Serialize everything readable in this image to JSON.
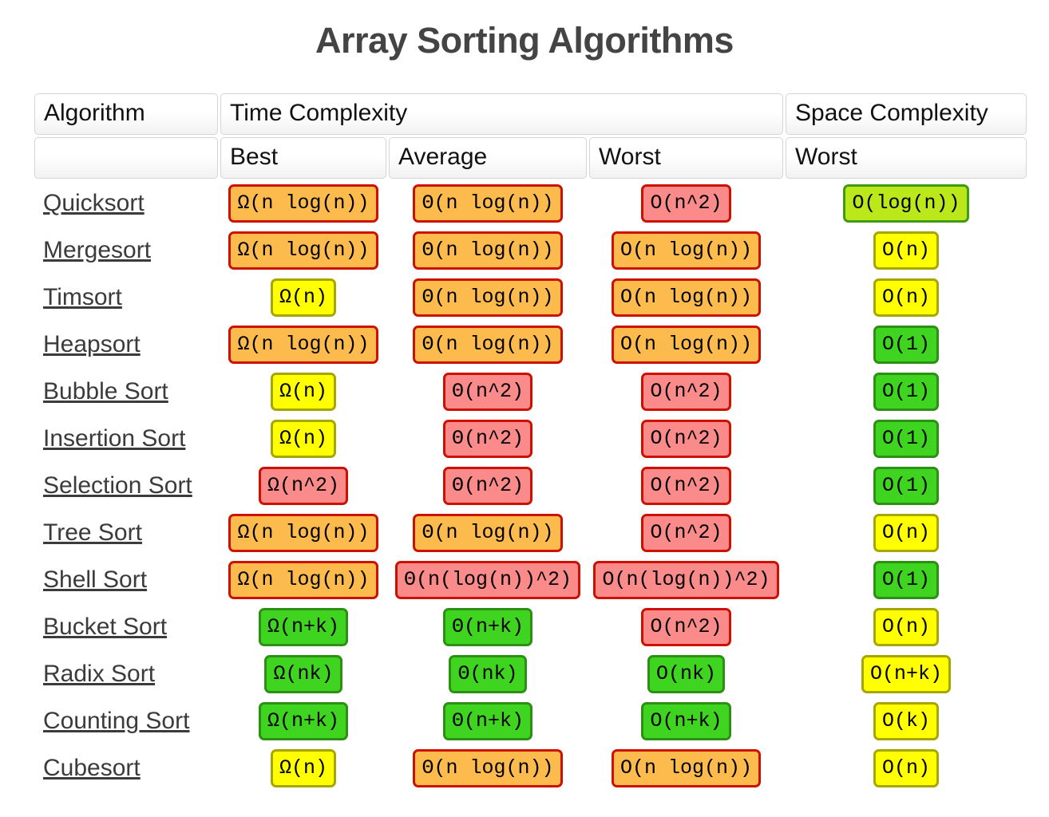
{
  "page": {
    "title": "Array Sorting Algorithms"
  },
  "table": {
    "group_headers": {
      "algorithm": "Algorithm",
      "time_complexity": "Time Complexity",
      "space_complexity": "Space Complexity"
    },
    "sub_headers": {
      "algorithm": "",
      "time_best": "Best",
      "time_average": "Average",
      "time_worst": "Worst",
      "space_worst": "Worst"
    },
    "legend_colors": {
      "excellent_bg": "#3fd41f",
      "excellent_border": "#2d8f14",
      "good_bg": "#bbe81a",
      "good_border": "#3f9b12",
      "fair_bg": "#ffff00",
      "fair_border": "#a6a600",
      "bad_bg": "#fdbb4d",
      "bad_border": "#cc1100",
      "horrible_bg": "#fb8a8a",
      "horrible_border": "#cc1100",
      "title_color": "#444444",
      "link_color": "#3b3b3b"
    },
    "rows": [
      {
        "name": "Quicksort",
        "time_best": {
          "text": "Ω(n log(n))",
          "level": "bad"
        },
        "time_average": {
          "text": "Θ(n log(n))",
          "level": "bad"
        },
        "time_worst": {
          "text": "O(n^2)",
          "level": "horrible"
        },
        "space_worst": {
          "text": "O(log(n))",
          "level": "good"
        }
      },
      {
        "name": "Mergesort",
        "time_best": {
          "text": "Ω(n log(n))",
          "level": "bad"
        },
        "time_average": {
          "text": "Θ(n log(n))",
          "level": "bad"
        },
        "time_worst": {
          "text": "O(n log(n))",
          "level": "bad"
        },
        "space_worst": {
          "text": "O(n)",
          "level": "fair"
        }
      },
      {
        "name": "Timsort",
        "time_best": {
          "text": "Ω(n)",
          "level": "fair"
        },
        "time_average": {
          "text": "Θ(n log(n))",
          "level": "bad"
        },
        "time_worst": {
          "text": "O(n log(n))",
          "level": "bad"
        },
        "space_worst": {
          "text": "O(n)",
          "level": "fair"
        }
      },
      {
        "name": "Heapsort",
        "time_best": {
          "text": "Ω(n log(n))",
          "level": "bad"
        },
        "time_average": {
          "text": "Θ(n log(n))",
          "level": "bad"
        },
        "time_worst": {
          "text": "O(n log(n))",
          "level": "bad"
        },
        "space_worst": {
          "text": "O(1)",
          "level": "excellent"
        }
      },
      {
        "name": "Bubble Sort",
        "time_best": {
          "text": "Ω(n)",
          "level": "fair"
        },
        "time_average": {
          "text": "Θ(n^2)",
          "level": "horrible"
        },
        "time_worst": {
          "text": "O(n^2)",
          "level": "horrible"
        },
        "space_worst": {
          "text": "O(1)",
          "level": "excellent"
        }
      },
      {
        "name": "Insertion Sort",
        "time_best": {
          "text": "Ω(n)",
          "level": "fair"
        },
        "time_average": {
          "text": "Θ(n^2)",
          "level": "horrible"
        },
        "time_worst": {
          "text": "O(n^2)",
          "level": "horrible"
        },
        "space_worst": {
          "text": "O(1)",
          "level": "excellent"
        }
      },
      {
        "name": "Selection Sort",
        "time_best": {
          "text": "Ω(n^2)",
          "level": "horrible"
        },
        "time_average": {
          "text": "Θ(n^2)",
          "level": "horrible"
        },
        "time_worst": {
          "text": "O(n^2)",
          "level": "horrible"
        },
        "space_worst": {
          "text": "O(1)",
          "level": "excellent"
        }
      },
      {
        "name": "Tree Sort",
        "time_best": {
          "text": "Ω(n log(n))",
          "level": "bad"
        },
        "time_average": {
          "text": "Θ(n log(n))",
          "level": "bad"
        },
        "time_worst": {
          "text": "O(n^2)",
          "level": "horrible"
        },
        "space_worst": {
          "text": "O(n)",
          "level": "fair"
        }
      },
      {
        "name": "Shell Sort",
        "time_best": {
          "text": "Ω(n log(n))",
          "level": "bad"
        },
        "time_average": {
          "text": "Θ(n(log(n))^2)",
          "level": "horrible"
        },
        "time_worst": {
          "text": "O(n(log(n))^2)",
          "level": "horrible"
        },
        "space_worst": {
          "text": "O(1)",
          "level": "excellent"
        }
      },
      {
        "name": "Bucket Sort",
        "time_best": {
          "text": "Ω(n+k)",
          "level": "excellent"
        },
        "time_average": {
          "text": "Θ(n+k)",
          "level": "excellent"
        },
        "time_worst": {
          "text": "O(n^2)",
          "level": "horrible"
        },
        "space_worst": {
          "text": "O(n)",
          "level": "fair"
        }
      },
      {
        "name": "Radix Sort",
        "time_best": {
          "text": "Ω(nk)",
          "level": "excellent"
        },
        "time_average": {
          "text": "Θ(nk)",
          "level": "excellent"
        },
        "time_worst": {
          "text": "O(nk)",
          "level": "excellent"
        },
        "space_worst": {
          "text": "O(n+k)",
          "level": "fair"
        }
      },
      {
        "name": "Counting Sort",
        "time_best": {
          "text": "Ω(n+k)",
          "level": "excellent"
        },
        "time_average": {
          "text": "Θ(n+k)",
          "level": "excellent"
        },
        "time_worst": {
          "text": "O(n+k)",
          "level": "excellent"
        },
        "space_worst": {
          "text": "O(k)",
          "level": "fair"
        }
      },
      {
        "name": "Cubesort",
        "time_best": {
          "text": "Ω(n)",
          "level": "fair"
        },
        "time_average": {
          "text": "Θ(n log(n))",
          "level": "bad"
        },
        "time_worst": {
          "text": "O(n log(n))",
          "level": "bad"
        },
        "space_worst": {
          "text": "O(n)",
          "level": "fair"
        }
      }
    ]
  }
}
